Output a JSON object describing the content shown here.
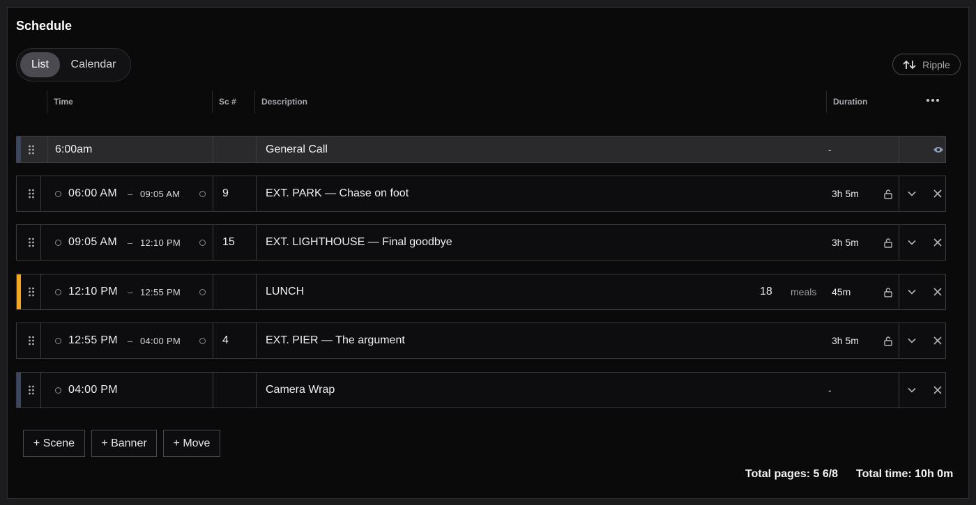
{
  "title": "Schedule",
  "view_toggle": {
    "list": "List",
    "calendar": "Calendar",
    "active": "list"
  },
  "ripple_label": "Ripple",
  "columns": {
    "time": "Time",
    "scene": "Sc #",
    "description": "Description",
    "duration": "Duration"
  },
  "rows": [
    {
      "kind": "call",
      "time": "6:00am",
      "description": "General Call",
      "duration": "-",
      "accent": "#3a475e"
    },
    {
      "kind": "scene",
      "start": "06:00 AM",
      "end": "09:05 AM",
      "scene": "9",
      "description": "EXT. PARK — Chase on foot",
      "duration": "3h 5m"
    },
    {
      "kind": "scene",
      "start": "09:05 AM",
      "end": "12:10 PM",
      "scene": "15",
      "description": "EXT. LIGHTHOUSE — Final goodbye",
      "duration": "3h 5m"
    },
    {
      "kind": "meal",
      "start": "12:10 PM",
      "end": "12:55 PM",
      "scene": "",
      "description": "LUNCH",
      "meals_count": "18",
      "meals_label": "meals",
      "duration": "45m",
      "accent": "#f5a623"
    },
    {
      "kind": "scene",
      "start": "12:55 PM",
      "end": "04:00 PM",
      "scene": "4",
      "description": "EXT. PIER — The argument",
      "duration": "3h 5m"
    },
    {
      "kind": "wrap",
      "start": "04:00 PM",
      "scene": "",
      "description": "Camera Wrap",
      "duration": "-",
      "accent": "#3a475e"
    }
  ],
  "time_dash": "–",
  "buttons": {
    "scene": "+ Scene",
    "banner": "+ Banner",
    "move": "+ Move"
  },
  "totals": {
    "pages": "Total pages: 5 6/8",
    "time": "Total time: 10h 0m"
  },
  "colors": {
    "background": "#0a0a0b",
    "meal_accent": "#f5a623",
    "call_accent": "#3a475e"
  }
}
